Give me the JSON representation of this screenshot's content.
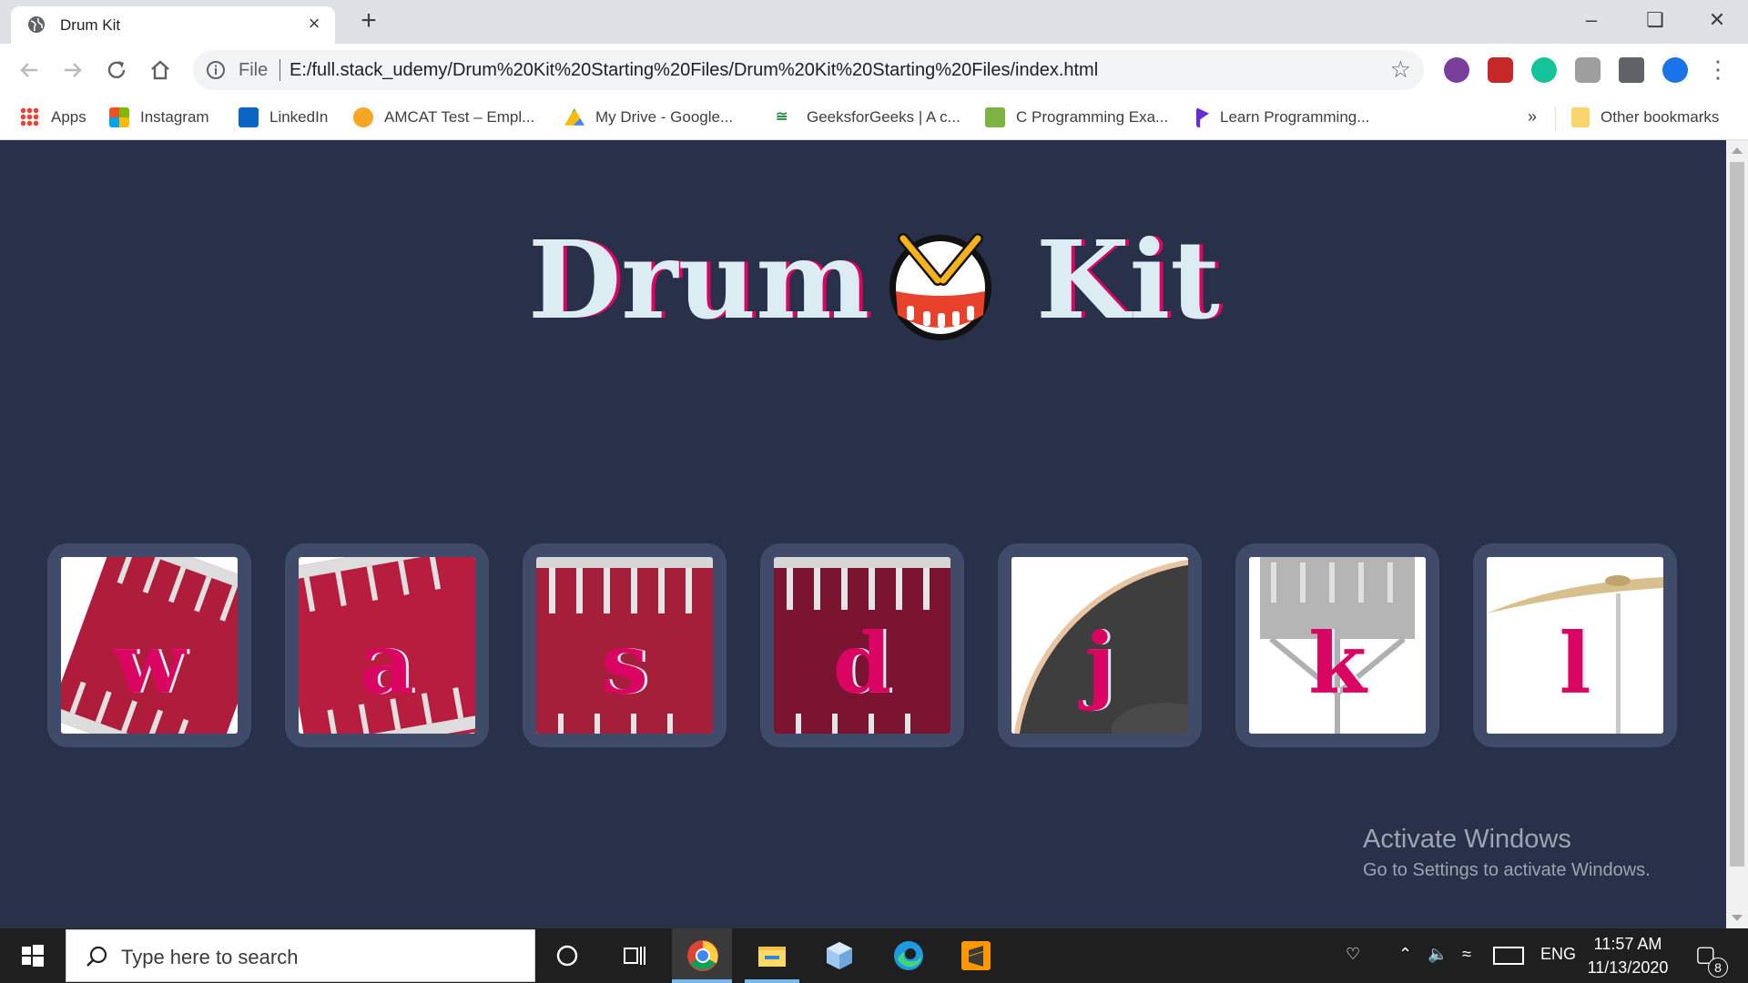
{
  "browser": {
    "tab_title": "Drum Kit",
    "new_tab_label": "+",
    "url_scheme": "File",
    "url": "E:/full.stack_udemy/Drum%20Kit%20Starting%20Files/Drum%20Kit%20Starting%20Files/index.html",
    "bookmarks": [
      {
        "label": "Apps",
        "icon": "apps-grid-icon",
        "color": "#4285f4"
      },
      {
        "label": "Instagram",
        "icon": "windows-logo-icon",
        "color": "#f25022"
      },
      {
        "label": "LinkedIn",
        "icon": "linkedin-icon",
        "color": "#0a66c2"
      },
      {
        "label": "AMCAT Test – Empl...",
        "icon": "amcat-icon",
        "color": "#f5a623"
      },
      {
        "label": "My Drive - Google...",
        "icon": "google-drive-icon",
        "color": "#34a853"
      },
      {
        "label": "GeeksforGeeks | A c...",
        "icon": "gfg-icon",
        "color": "#2f8d46"
      },
      {
        "label": "C Programming Exa...",
        "icon": "c-programming-icon",
        "color": "#7cb342"
      },
      {
        "label": "Learn Programming...",
        "icon": "programiz-icon",
        "color": "#6c2bd9"
      }
    ],
    "overflow_label": "»",
    "other_bookmarks": "Other bookmarks"
  },
  "page": {
    "title_left": "Drum",
    "title_right": "Kit",
    "emoji_icon": "drum-emoji-icon",
    "drums": [
      {
        "key": "w",
        "name": "tom-1"
      },
      {
        "key": "a",
        "name": "tom-2"
      },
      {
        "key": "s",
        "name": "tom-3"
      },
      {
        "key": "d",
        "name": "tom-4"
      },
      {
        "key": "j",
        "name": "snare"
      },
      {
        "key": "k",
        "name": "crash"
      },
      {
        "key": "l",
        "name": "kick"
      }
    ],
    "colors": {
      "background": "#283149",
      "tile": "#404b69",
      "accent": "#da0463",
      "title": "#dbedf3"
    }
  },
  "watermark": {
    "line1": "Activate Windows",
    "line2": "Go to Settings to activate Windows."
  },
  "taskbar": {
    "search_placeholder": "Type here to search",
    "language": "ENG",
    "time": "11:57 AM",
    "date": "11/13/2020",
    "notification_count": "8"
  }
}
